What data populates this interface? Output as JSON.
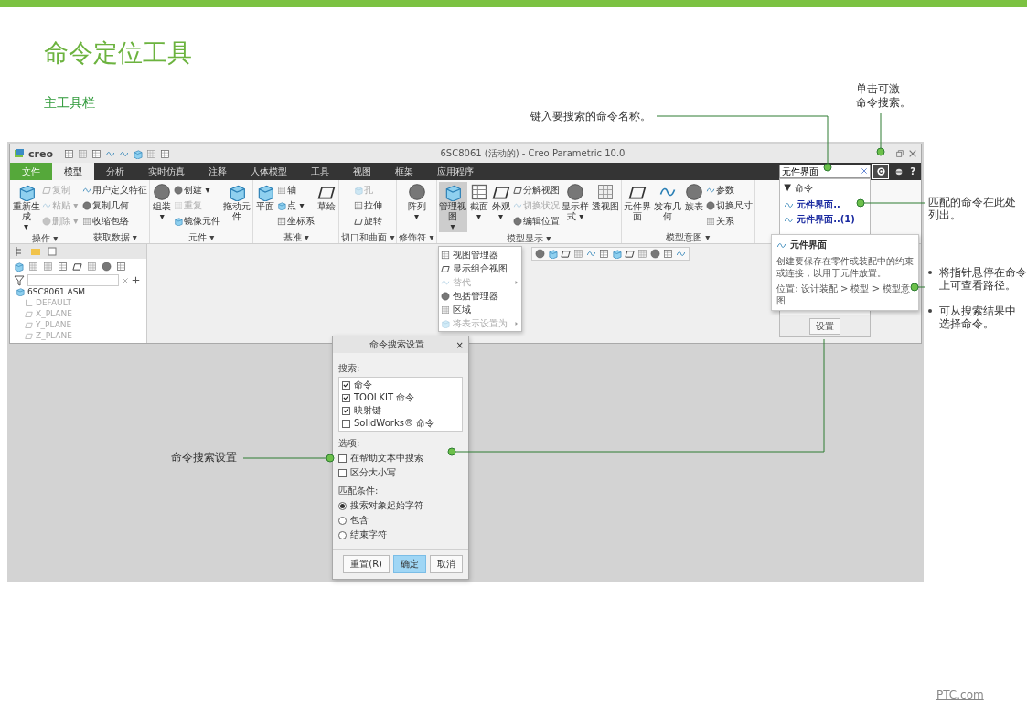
{
  "title": "命令定位工具",
  "subtitle": "主工具栏",
  "app": {
    "logo": "creo",
    "window_title": "6SC8061 (活动的) - Creo Parametric 10.0",
    "tabs": [
      {
        "label": "文件",
        "kind": "file",
        "selected": false
      },
      {
        "label": "模型",
        "kind": "tab",
        "selected": true
      },
      {
        "label": "分析",
        "kind": "tab",
        "selected": false
      },
      {
        "label": "实时仿真",
        "kind": "tab",
        "selected": false
      },
      {
        "label": "注释",
        "kind": "tab",
        "selected": false
      },
      {
        "label": "人体模型",
        "kind": "tab",
        "selected": false
      },
      {
        "label": "工具",
        "kind": "tab",
        "selected": false
      },
      {
        "label": "视图",
        "kind": "tab",
        "selected": false
      },
      {
        "label": "框架",
        "kind": "tab",
        "selected": false
      },
      {
        "label": "应用程序",
        "kind": "tab",
        "selected": false
      }
    ],
    "search": {
      "value": "元件界面",
      "help": "?"
    },
    "ribbon": [
      {
        "label": "操作 ▾",
        "items": [
          {
            "kind": "big",
            "label": "重新生成",
            "caret": "▾",
            "selected": false
          },
          {
            "kind": "small_column",
            "items": [
              {
                "label": "复制",
                "disabled": true
              },
              {
                "label": "粘贴 ▾",
                "disabled": true
              },
              {
                "label": "删除 ▾",
                "disabled": true
              }
            ]
          }
        ]
      },
      {
        "label": "获取数据 ▾",
        "items": [
          {
            "kind": "small_column",
            "items": [
              {
                "label": "用户定义特征",
                "disabled": false
              },
              {
                "label": "复制几何",
                "disabled": false
              },
              {
                "label": "收缩包络",
                "disabled": false
              }
            ]
          }
        ]
      },
      {
        "label": "元件 ▾",
        "items": [
          {
            "kind": "big",
            "label": "组装",
            "caret": "▾",
            "selected": false
          },
          {
            "kind": "small_column",
            "items": [
              {
                "label": "创建 ▾",
                "disabled": false
              },
              {
                "label": "重复",
                "disabled": true
              },
              {
                "label": "镜像元件",
                "disabled": false
              }
            ]
          },
          {
            "kind": "big",
            "label": "拖动元件",
            "selected": false
          }
        ]
      },
      {
        "label": "基准 ▾",
        "items": [
          {
            "kind": "big",
            "label": "平面",
            "selected": false
          },
          {
            "kind": "small_column",
            "items": [
              {
                "label": "轴",
                "disabled": false
              },
              {
                "label": "点 ▾",
                "disabled": false
              },
              {
                "label": "坐标系",
                "disabled": false
              }
            ]
          },
          {
            "kind": "big",
            "label": "草绘",
            "selected": false
          }
        ]
      },
      {
        "label": "切口和曲面 ▾",
        "items": [
          {
            "kind": "small_column",
            "items": [
              {
                "label": "孔",
                "disabled": true
              },
              {
                "label": "拉伸",
                "disabled": false
              },
              {
                "label": "旋转",
                "disabled": false
              }
            ]
          }
        ]
      },
      {
        "label": "修饰符 ▾",
        "items": [
          {
            "kind": "big",
            "label": "阵列",
            "caret": "▾",
            "selected": false
          }
        ]
      },
      {
        "label": "模型显示 ▾",
        "items": [
          {
            "kind": "big",
            "label": "管理视图",
            "caret": "▾",
            "selected": true
          },
          {
            "kind": "big",
            "label": "截面",
            "caret": "▾",
            "selected": false
          },
          {
            "kind": "big",
            "label": "外观",
            "caret": "▾",
            "selected": false
          },
          {
            "kind": "small_column",
            "items": [
              {
                "label": "分解视图",
                "disabled": false
              },
              {
                "label": "切换状况",
                "disabled": true
              },
              {
                "label": "编辑位置",
                "disabled": false
              }
            ]
          },
          {
            "kind": "big",
            "label": "显示样式 ▾",
            "selected": false
          },
          {
            "kind": "big",
            "label": "透视图",
            "selected": false
          }
        ]
      },
      {
        "label": "模型意图 ▾",
        "items": [
          {
            "kind": "big",
            "label": "元件界面",
            "selected": false
          },
          {
            "kind": "big",
            "label": "发布几何",
            "selected": false
          },
          {
            "kind": "big",
            "label": "族表",
            "selected": false
          },
          {
            "kind": "small_column",
            "items": [
              {
                "label": "参数",
                "disabled": false
              },
              {
                "label": "切换尺寸",
                "disabled": false
              },
              {
                "label": "关系",
                "disabled": false
              }
            ]
          }
        ]
      }
    ],
    "view_menu": [
      {
        "label": "视图管理器",
        "disabled": false,
        "submenu": false
      },
      {
        "label": "显示组合视图",
        "disabled": false,
        "submenu": false
      },
      {
        "label": "替代",
        "disabled": true,
        "submenu": true
      },
      {
        "label": "包括管理器",
        "disabled": false,
        "submenu": false
      },
      {
        "label": "区域",
        "disabled": false,
        "submenu": false
      },
      {
        "label": "将表示设置为",
        "disabled": true,
        "submenu": true
      }
    ],
    "tree": [
      {
        "label": "6SC8061.ASM",
        "kind": "assembly",
        "children": [
          {
            "label": "DEFAULT",
            "kind": "csys"
          },
          {
            "label": "X_PLANE",
            "kind": "plane"
          },
          {
            "label": "Y_PLANE",
            "kind": "plane"
          },
          {
            "label": "Z_PLANE",
            "kind": "plane"
          }
        ]
      }
    ],
    "results": {
      "toggle": "▼",
      "group": "命令",
      "items": [
        "元件界面..",
        "元件界面..(1)"
      ],
      "settings_button": "设置"
    },
    "tooltip": {
      "title": "元件界面",
      "description": "创建要保存在零件或装配中的约束或连接，以用于元件放置。",
      "location": "位置: 设计装配 > 模型 > 模型意图"
    }
  },
  "dialog": {
    "title": "命令搜索设置",
    "close": "×",
    "search_label": "搜索:",
    "search_in": [
      {
        "label": "命令",
        "checked": true
      },
      {
        "label": "TOOLKIT 命令",
        "checked": true
      },
      {
        "label": "映射键",
        "checked": true
      },
      {
        "label": "SolidWorks® 命令",
        "checked": false
      }
    ],
    "options_label": "选项:",
    "options": [
      {
        "label": "在帮助文本中搜索",
        "checked": false
      },
      {
        "label": "区分大小写",
        "checked": false
      }
    ],
    "match_label": "匹配条件:",
    "match": [
      {
        "label": "搜索对象起始字符",
        "selected": true
      },
      {
        "label": "包含",
        "selected": false
      },
      {
        "label": "结束字符",
        "selected": false
      }
    ],
    "buttons": [
      {
        "label": "重置(R)",
        "kind": "normal"
      },
      {
        "label": "确定",
        "kind": "primary"
      },
      {
        "label": "取消",
        "kind": "normal"
      }
    ]
  },
  "annotations": {
    "search_field": "键入要搜索的命令名称。",
    "search_button": [
      "单击可激",
      "命令搜索。"
    ],
    "results": "匹配的命令在此处列出。",
    "bullets": [
      [
        "将指针悬停在命令",
        "上可查看路径。"
      ],
      [
        "可从搜索结果中",
        "选择命令。"
      ]
    ],
    "dialog": "命令搜索设置"
  },
  "footer_link": "PTC.com"
}
